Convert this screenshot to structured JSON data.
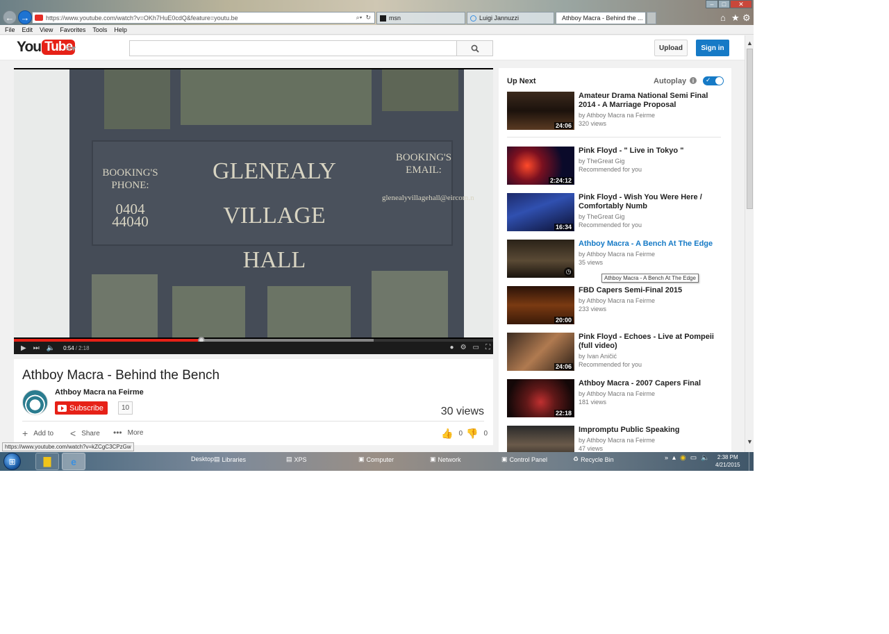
{
  "browser": {
    "url": "https://www.youtube.com/watch?v=OKh7HuE0cdQ&feature=youtu.be",
    "tabs": [
      {
        "label": "msn"
      },
      {
        "label": "Luigi Jannuzzi"
      },
      {
        "label": "Athboy Macra - Behind the ..."
      }
    ],
    "menu": [
      "File",
      "Edit",
      "View",
      "Favorites",
      "Tools",
      "Help"
    ],
    "status_url": "https://www.youtube.com/watch?v=kZCgC3CPzGw"
  },
  "header": {
    "logo_you": "You",
    "logo_tube": "Tube",
    "search_placeholder": "",
    "upload_label": "Upload",
    "signin_label": "Sign in"
  },
  "player": {
    "sign_text_left_line1": "BOOKING'S",
    "sign_text_left_line2": "PHONE:",
    "sign_text_left_number": "0404 44040",
    "sign_text_center_line1": "GLENEALY VILLAGE",
    "sign_text_center_line2": "HALL",
    "sign_text_right_line1": "BOOKING'S",
    "sign_text_right_line2": "EMAIL:",
    "sign_text_right_email": "glenealyvillagehall@eircom.n",
    "time_current": "0:54",
    "time_separator": "/",
    "time_duration": "2:18",
    "progress_fraction": 0.391,
    "buffered_fraction": 0.75
  },
  "video": {
    "title": "Athboy Macra - Behind the Bench",
    "channel": "Athboy Macra na Feirme",
    "subscribe_label": "Subscribe",
    "subscriber_count": "10",
    "views": "30 views",
    "actions": {
      "add_to": "Add to",
      "share": "Share",
      "more": "More",
      "likes": "0",
      "dislikes": "0"
    }
  },
  "sidebar": {
    "up_next_label": "Up Next",
    "autoplay_label": "Autoplay",
    "autoplay_on": true,
    "tooltip": "Athboy Macra -  A Bench At The Edge",
    "items": [
      {
        "title": "Amateur Drama National Semi Final 2014 - A Marriage Proposal",
        "channel": "by Athboy Macra na Feirme",
        "meta": "320 views",
        "duration": "24:06"
      },
      {
        "title": "Pink Floyd - \" Live in Tokyo \"",
        "channel": "by TheGreat Gig",
        "meta": "Recommended for you",
        "duration": "2:24:12"
      },
      {
        "title": "Pink Floyd - Wish You Were Here / Comfortably Numb",
        "channel": "by TheGreat Gig",
        "meta": "Recommended for you",
        "duration": "16:34"
      },
      {
        "title": "Athboy Macra - A Bench At The Edge",
        "channel": "by Athboy Macra na Feirme",
        "meta": "35 views",
        "duration": ""
      },
      {
        "title": "FBD Capers Semi-Final 2015",
        "channel": "by Athboy Macra na Feirme",
        "meta": "233 views",
        "duration": "20:00"
      },
      {
        "title": "Pink Floyd - Echoes - Live at Pompeii (full video)",
        "channel": "by Ivan Aničić",
        "meta": "Recommended for you",
        "duration": "24:06"
      },
      {
        "title": "Athboy Macra - 2007 Capers Final",
        "channel": "by Athboy Macra na Feirme",
        "meta": "181 views",
        "duration": "22:18"
      },
      {
        "title": "Impromptu Public Speaking",
        "channel": "by Athboy Macra na Feirme",
        "meta": "47 views",
        "duration": ""
      }
    ]
  },
  "taskbar": {
    "quick_links": [
      "Desktop",
      "Libraries",
      "XPS",
      "Computer",
      "Network",
      "Control Panel",
      "Recycle Bin"
    ],
    "time": "2:38 PM",
    "date": "4/21/2015"
  },
  "colors": {
    "youtube_red": "#e62117",
    "link_blue": "#167ac6"
  }
}
